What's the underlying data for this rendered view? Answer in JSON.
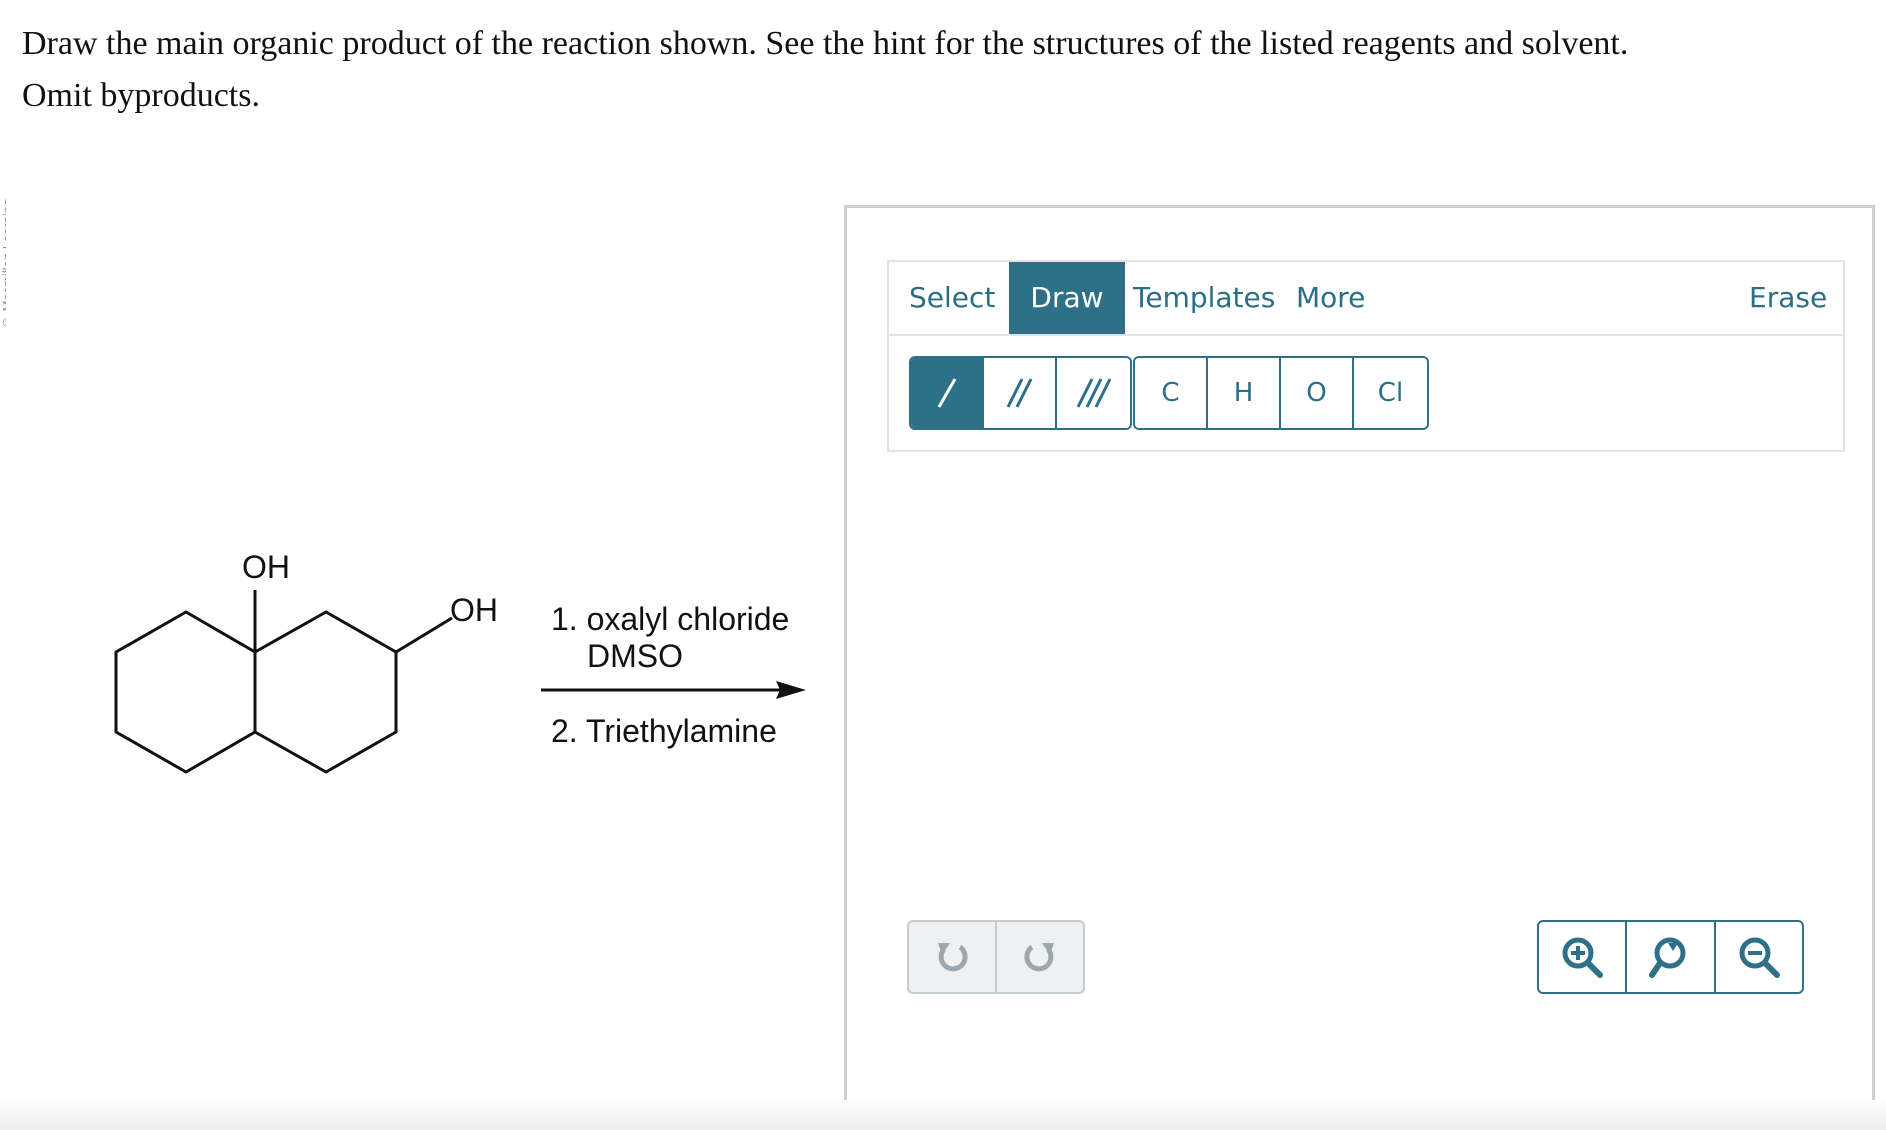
{
  "side_strip_text": "© Macmillan Learning",
  "question": {
    "line1": "Draw the main organic product of the reaction shown. See the hint for the structures of the listed reagents and solvent.",
    "line2": "Omit byproducts."
  },
  "reaction": {
    "oh_top": "OH",
    "oh_side": "OH",
    "reagent_1": "1. oxalyl chloride",
    "reagent_1b": "DMSO",
    "reagent_2": "2. Triethylamine"
  },
  "editor": {
    "tabs": {
      "select": "Select",
      "draw": "Draw",
      "templates": "Templates",
      "more": "More",
      "erase": "Erase"
    },
    "bond_tools": [
      "single-bond-icon",
      "double-bond-icon",
      "triple-bond-icon"
    ],
    "atoms": [
      "C",
      "H",
      "O",
      "Cl"
    ],
    "undo_icon": "undo-icon",
    "redo_icon": "redo-icon",
    "zoom_icons": [
      "zoom-in-icon",
      "zoom-reset-icon",
      "zoom-out-icon"
    ]
  },
  "colors": {
    "accent": "#2f7089",
    "tab_text": "#2b6f86",
    "border": "#cfcfcf"
  }
}
